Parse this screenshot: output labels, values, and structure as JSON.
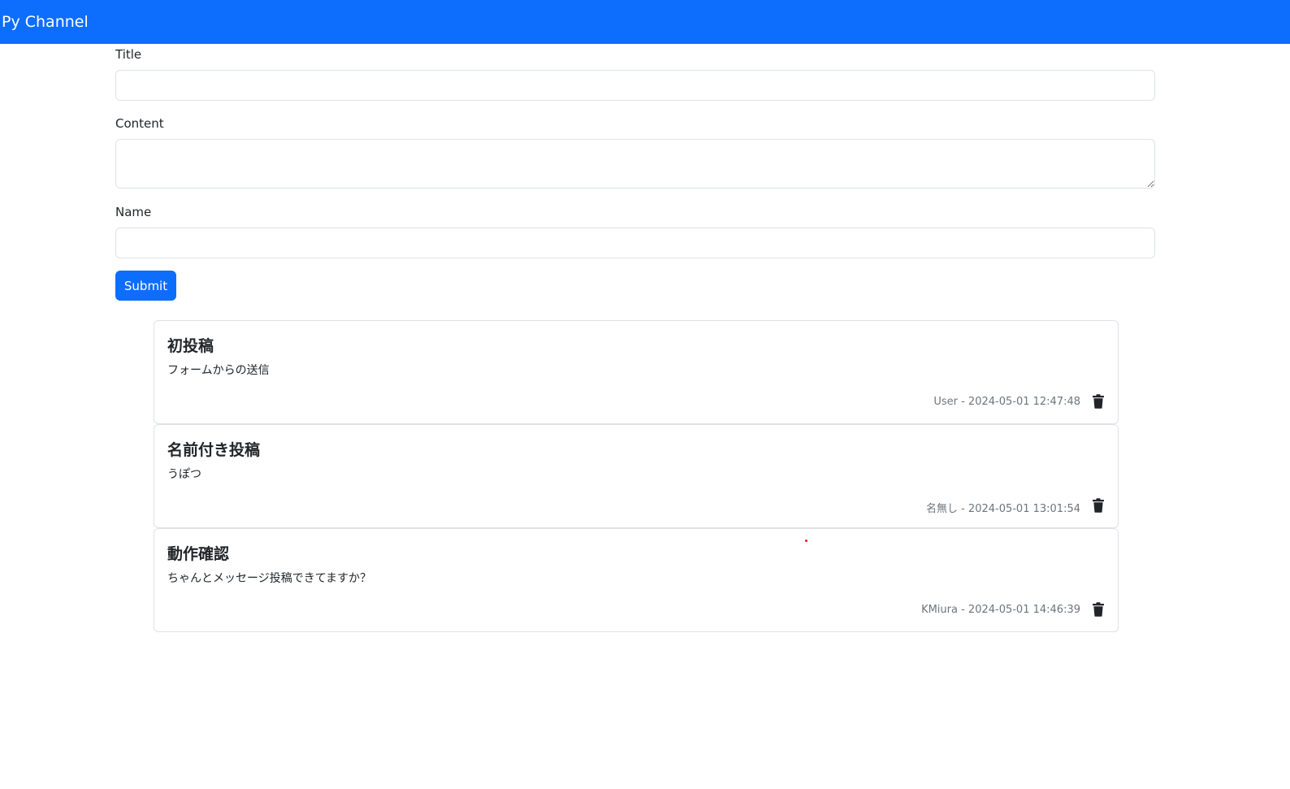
{
  "navbar": {
    "brand": "Py Channel"
  },
  "form": {
    "title_label": "Title",
    "title_value": "",
    "content_label": "Content",
    "content_value": "",
    "name_label": "Name",
    "name_value": "",
    "submit_label": "Submit"
  },
  "posts": [
    {
      "title": "初投稿",
      "content": "フォームからの送信",
      "meta": "User - 2024-05-01 12:47:48"
    },
    {
      "title": "名前付き投稿",
      "content": "うぽつ",
      "meta": "名無し - 2024-05-01 13:01:54"
    },
    {
      "title": "動作確認",
      "content": "ちゃんとメッセージ投稿できてますか？",
      "meta": "KMiura - 2024-05-01 14:46:39"
    }
  ],
  "icons": {
    "delete": "trash-icon"
  },
  "colors": {
    "primary": "#0d6efd",
    "meta_text": "#6c757d"
  }
}
